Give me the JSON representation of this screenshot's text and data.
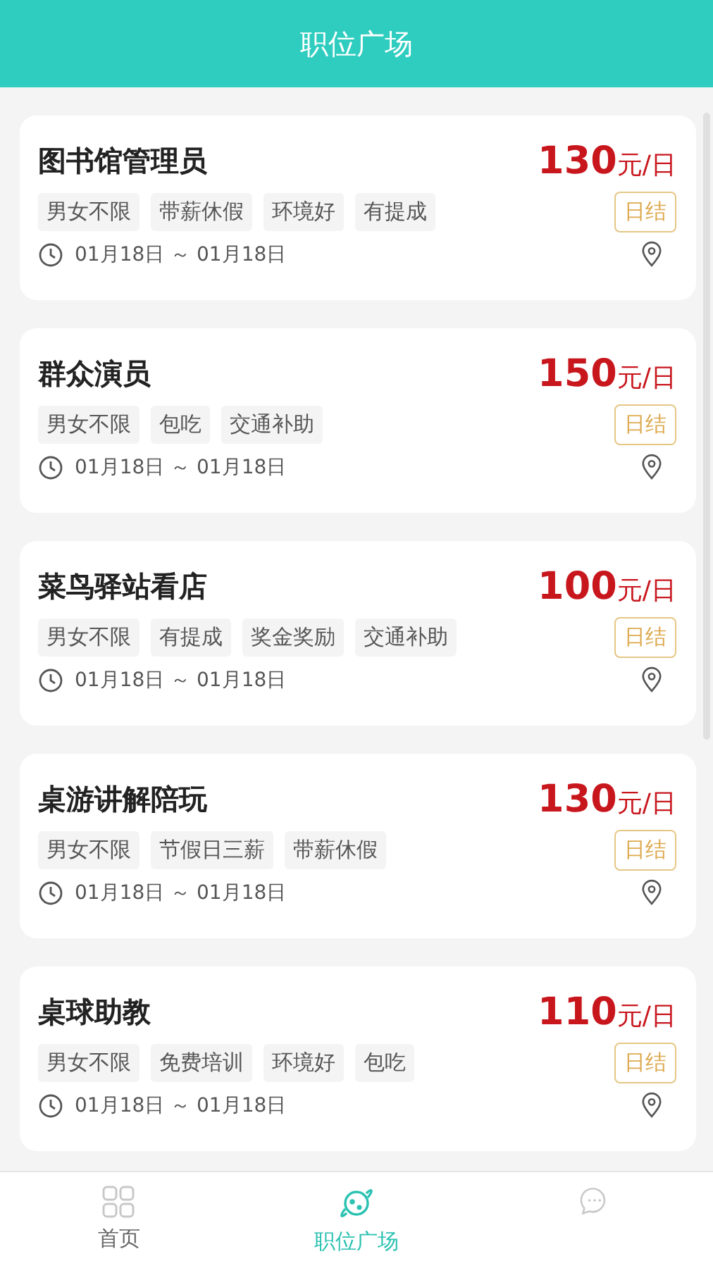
{
  "header": {
    "title": "职位广场"
  },
  "jobs": [
    {
      "title": "图书馆管理员",
      "price": "130",
      "unit": "元/日",
      "tags": [
        "男女不限",
        "带薪休假",
        "环境好",
        "有提成"
      ],
      "settlement": "日结",
      "date": "01月18日 ～ 01月18日"
    },
    {
      "title": "群众演员",
      "price": "150",
      "unit": "元/日",
      "tags": [
        "男女不限",
        "包吃",
        "交通补助"
      ],
      "settlement": "日结",
      "date": "01月18日 ～ 01月18日"
    },
    {
      "title": "菜鸟驿站看店",
      "price": "100",
      "unit": "元/日",
      "tags": [
        "男女不限",
        "有提成",
        "奖金奖励",
        "交通补助"
      ],
      "settlement": "日结",
      "date": "01月18日 ～ 01月18日"
    },
    {
      "title": "桌游讲解陪玩",
      "price": "130",
      "unit": "元/日",
      "tags": [
        "男女不限",
        "节假日三薪",
        "带薪休假"
      ],
      "settlement": "日结",
      "date": "01月18日 ～ 01月18日"
    },
    {
      "title": "桌球助教",
      "price": "110",
      "unit": "元/日",
      "tags": [
        "男女不限",
        "免费培训",
        "环境好",
        "包吃"
      ],
      "settlement": "日结",
      "date": "01月18日 ～ 01月18日"
    }
  ],
  "nav": [
    {
      "kind": "grid",
      "label": "首页",
      "selected": false
    },
    {
      "kind": "planet",
      "label": "职位广场",
      "selected": true
    },
    {
      "kind": "chat",
      "selected": false
    }
  ]
}
